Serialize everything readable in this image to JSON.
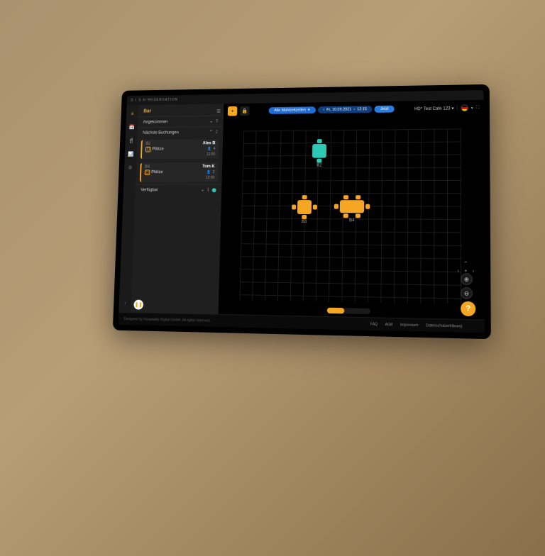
{
  "app_title": "D I S H  RESERVATION",
  "restaurant_name": "HD* Test Cafe 123",
  "sidebar": {
    "room_label": "Bar",
    "arrived": {
      "label": "Angekommen",
      "count": "0"
    },
    "upcoming": {
      "label": "Nächste Buchungen",
      "count": "2"
    },
    "reservations": [
      {
        "table": "B2",
        "seats_label": "Plätze",
        "name": "Alex B",
        "guests": "4",
        "time": "12:00"
      },
      {
        "table": "B4",
        "seats_label": "Plätze",
        "name": "Tom K",
        "guests": "2",
        "time": "12:30"
      }
    ],
    "available": {
      "label": "Verfügbar",
      "count": "1"
    }
  },
  "toolbar": {
    "meal_filter": "Alle Mahlzeitzeiten",
    "date": "Fr, 10.09.2021",
    "time": "12:15",
    "now_label": "Jetzt"
  },
  "tables": [
    {
      "id": "B2",
      "label": "B2"
    },
    {
      "id": "B3",
      "label": "B3"
    },
    {
      "id": "B4",
      "label": "B4"
    }
  ],
  "footer": {
    "copyright": "Designed by Hospitality Digital GmbH. All rights reserved.",
    "links": [
      "FAQ",
      "AGB",
      "Impressum",
      "Datenschutzerklärung"
    ]
  },
  "icons": {
    "layers": "≣",
    "lock": "🔒",
    "plus": "+",
    "help": "?",
    "pause": "❚❚",
    "fullscreen": "⛶",
    "zoom_in": "⊕",
    "zoom_out": "⊖",
    "person": "👤",
    "chev_left": "‹",
    "chev_right": "›",
    "chev_down": "⌄",
    "chev_up": "⌃",
    "caret": "▾"
  },
  "rail": [
    "≡",
    "📅",
    "🍴",
    "📊",
    "⚙",
    "‹"
  ]
}
